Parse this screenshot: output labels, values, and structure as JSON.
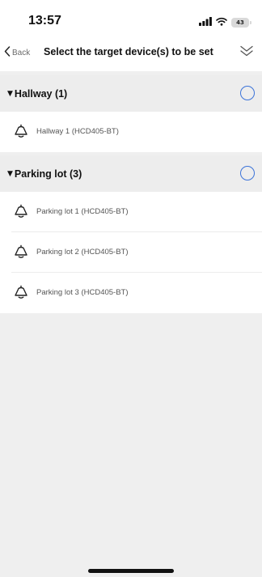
{
  "status_bar": {
    "time": "13:57",
    "battery_level": "43",
    "icons": [
      "signal-icon",
      "wifi-icon",
      "battery-icon"
    ]
  },
  "nav": {
    "back_label": "Back",
    "title": "Select the target device(s) to be set",
    "expand_icon": "double-chevron-down-icon"
  },
  "groups": [
    {
      "title": "Hallway (1)",
      "devices": [
        {
          "name": "Hallway 1 (HCD405-BT)",
          "icon": "bell-icon"
        }
      ]
    },
    {
      "title": "Parking lot (3)",
      "devices": [
        {
          "name": "Parking lot 1 (HCD405-BT)",
          "icon": "bell-icon"
        },
        {
          "name": "Parking lot 2 (HCD405-BT)",
          "icon": "bell-icon"
        },
        {
          "name": "Parking lot 3 (HCD405-BT)",
          "icon": "bell-icon"
        }
      ]
    }
  ],
  "colors": {
    "accent": "#3b73d9",
    "group_header_bg": "#ededed",
    "page_bg": "#efefef"
  }
}
